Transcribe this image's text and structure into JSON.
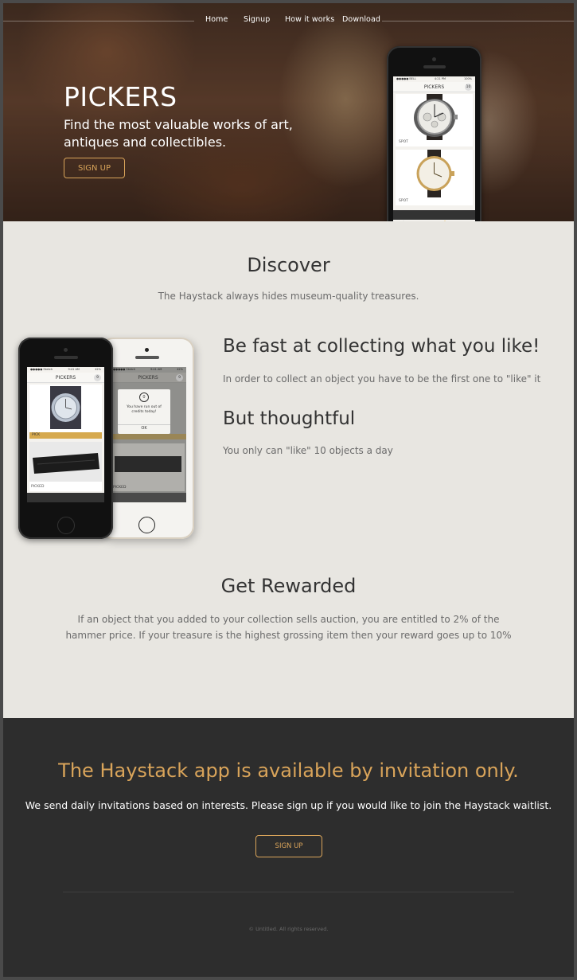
{
  "nav": {
    "items": [
      "Home",
      "Signup",
      "How it works",
      "Download"
    ]
  },
  "hero": {
    "title": "PICKERS",
    "subtitle": "Find the most valuable works of art, antiques and collectibles.",
    "signup_label": "SIGN UP"
  },
  "hero_phone": {
    "status_left": "●●●●● BELL",
    "status_time": "4:21 PM",
    "status_right": "100%",
    "app_title": "PICKERS",
    "badge": "10",
    "card_labels": [
      "SPOT",
      "SPOT"
    ]
  },
  "discover": {
    "title": "Discover",
    "text": "The Haystack always hides museum-quality treasures."
  },
  "features": [
    {
      "title": "Be fast at collecting what you like!",
      "text": "In order to collect an object you have to be the first one to \"like\" it"
    },
    {
      "title": "But thoughtful",
      "text": "You only can \"like\" 10 objects a day"
    }
  ],
  "phone_left": {
    "status_left": "●●●●● Sketch",
    "status_time": "9:41 AM",
    "status_right": "42%",
    "app_title": "PICKERS",
    "badge": "9",
    "bar_label": "PICK",
    "item_label": "PICKED"
  },
  "phone_right": {
    "status_left": "●●●●● Sketch",
    "status_time": "9:41 AM",
    "status_right": "42%",
    "app_title": "PICKERS",
    "badge": "9",
    "dialog_count": "0",
    "dialog_text": "You have run out of credits today!",
    "dialog_ok": "OK",
    "item_label": "PICKED"
  },
  "rewarded": {
    "title": "Get Rewarded",
    "text": "If an object that you added to your collection sells auction, you are entitled to 2% of the hammer price. If your treasure is the highest grossing item then your reward goes up to 10%"
  },
  "cta": {
    "title": "The Haystack app is available by invitation only.",
    "text": "We send daily invitations based on interests. Please sign up if you would like to join the Haystack waitlist.",
    "signup_label": "SIGN UP"
  },
  "footer": {
    "copyright": "© Untitled. All rights reserved."
  },
  "colors": {
    "accent": "#d9a45a",
    "light_bg": "#e8e6e1",
    "dark_bg": "#2d2d2d",
    "tab_active": "#e6b84a"
  },
  "icons": [
    "home-icon",
    "gift-icon",
    "user-icon",
    "bell-icon"
  ]
}
